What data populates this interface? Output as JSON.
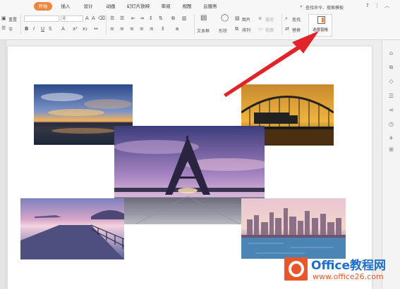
{
  "ribbon": {
    "tabs": [
      {
        "label": "开始",
        "active": true
      },
      {
        "label": "插入"
      },
      {
        "label": "设计"
      },
      {
        "label": "动画"
      },
      {
        "label": "幻灯片放映"
      },
      {
        "label": "审阅"
      },
      {
        "label": "视图"
      },
      {
        "label": "云服务"
      }
    ],
    "search_label": "查找命令、搜索模板",
    "reset_label": "重置",
    "section_label": "节",
    "font_size_value": "0",
    "text_box_label": "文本框",
    "shape_label": "形状",
    "picture_label": "图片",
    "arrange_label": "排列",
    "fill_label": "填充",
    "outline_label": "轮廓",
    "find_label": "查找",
    "replace_label": "替换",
    "selection_pane_label": "选择窗格"
  },
  "watermark": {
    "brand": "Office教程网",
    "url": "www.office26.com"
  },
  "colors": {
    "accent": "#f0853b",
    "arrow": "#e1232a",
    "brand_blue": "#1e6fc9",
    "brand_orange": "#e8562a"
  },
  "slide_images": [
    {
      "name": "sunset-lake-photo"
    },
    {
      "name": "bridge-truck-photo"
    },
    {
      "name": "eiffel-tower-photo"
    },
    {
      "name": "pier-dusk-photo"
    },
    {
      "name": "city-skyline-photo"
    }
  ]
}
